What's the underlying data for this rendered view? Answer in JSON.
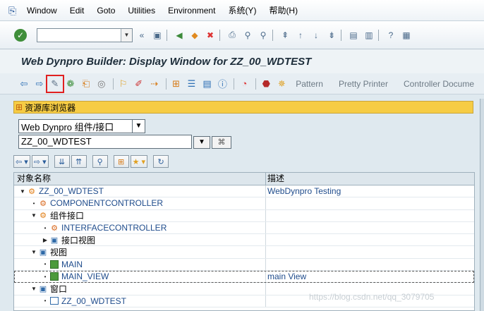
{
  "menubar": {
    "items": [
      "Window",
      "Edit",
      "Goto",
      "Utilities",
      "Environment",
      "系统(Y)",
      "帮助(H)"
    ]
  },
  "systoolbar": {
    "command_value": "",
    "back_label": "«"
  },
  "title": "Web Dynpro Builder: Display Window for ZZ_00_WDTEST",
  "apptoolbar": {
    "pattern": "Pattern",
    "pretty_printer": "Pretty Printer",
    "controller_doc": "Controller Docume"
  },
  "repository": {
    "header": "资源库浏览器",
    "object_type": "Web Dynpro 组件/接口",
    "object_name": "ZZ_00_WDTEST"
  },
  "tree": {
    "col_name": "对象名称",
    "col_desc": "描述",
    "rows": [
      {
        "label": "ZZ_00_WDTEST",
        "desc": "WebDynpro Testing"
      },
      {
        "label": "COMPONENTCONTROLLER",
        "desc": ""
      },
      {
        "label": "组件接口",
        "desc": ""
      },
      {
        "label": "INTERFACECONTROLLER",
        "desc": ""
      },
      {
        "label": "接口视图",
        "desc": ""
      },
      {
        "label": "视图",
        "desc": ""
      },
      {
        "label": "MAIN",
        "desc": ""
      },
      {
        "label": "MAIN_VIEW",
        "desc": "main View"
      },
      {
        "label": "窗口",
        "desc": ""
      },
      {
        "label": "ZZ_00_WDTEST",
        "desc": ""
      }
    ]
  },
  "watermark": "https://blog.csdn.net/qq_3079705"
}
